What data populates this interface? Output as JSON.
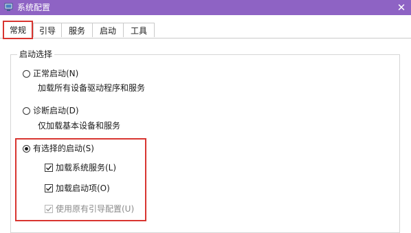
{
  "window": {
    "title": "系统配置",
    "close_glyph": "✕",
    "accent_color": "#8e63c4",
    "highlight_color": "#d8342f"
  },
  "tabs": [
    {
      "label": "常规",
      "active": true
    },
    {
      "label": "引导",
      "active": false
    },
    {
      "label": "服务",
      "active": false
    },
    {
      "label": "启动",
      "active": false
    },
    {
      "label": "工具",
      "active": false
    }
  ],
  "startup_selection": {
    "legend": "启动选择",
    "options": [
      {
        "label": "正常启动(N)",
        "description": "加载所有设备驱动程序和服务",
        "selected": false
      },
      {
        "label": "诊断启动(D)",
        "description": "仅加载基本设备和服务",
        "selected": false
      },
      {
        "label": "有选择的启动(S)",
        "selected": true
      }
    ],
    "selective_items": [
      {
        "label": "加载系统服务(L)",
        "checked": true,
        "enabled": true
      },
      {
        "label": "加载启动项(O)",
        "checked": true,
        "enabled": true
      },
      {
        "label": "使用原有引导配置(U)",
        "checked": true,
        "enabled": false
      }
    ]
  }
}
